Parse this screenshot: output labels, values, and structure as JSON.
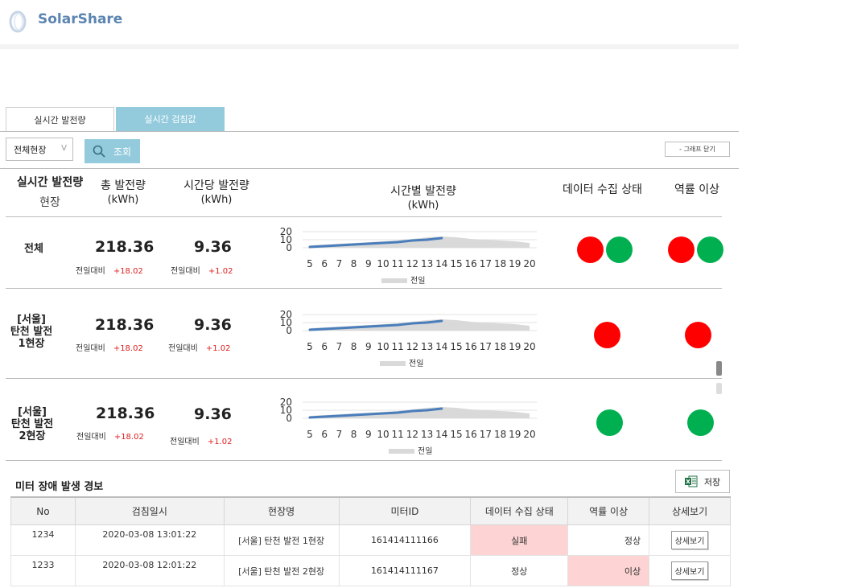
{
  "header": {
    "brand": "SolarShare"
  },
  "tabs": [
    {
      "label": "실시간 발전량"
    },
    {
      "label": "실시간 검침값"
    }
  ],
  "filter": {
    "site_select": "전체현장",
    "select_chevron": "V",
    "search_label": "조회",
    "graph_close_label": "- 그래프 닫기"
  },
  "columns": {
    "c1_top": "실시간 발전량",
    "c1_sub": "현장",
    "c2_top": "총 발전량",
    "c2_sub": "(kWh)",
    "c3_top": "시간당 발전량",
    "c3_sub": "(kWh)",
    "c4_top": "시간별 발전량",
    "c4_sub": "(kWh)",
    "c5_top": "데이터 수집 상태",
    "c6_top": "역률 이상"
  },
  "compare_label": "전일대비",
  "rows": [
    {
      "name_line1": "전체",
      "name_line2": "",
      "name_line3": "",
      "total": "218.36",
      "total_delta": "+18.02",
      "hourly": "9.36",
      "hourly_delta": "+1.02"
    },
    {
      "name_line1": "[서울]",
      "name_line2": "탄천 발전",
      "name_line3": "1현장",
      "total": "218.36",
      "total_delta": "+18.02",
      "hourly": "9.36",
      "hourly_delta": "+1.02"
    },
    {
      "name_line1": "[서울]",
      "name_line2": "탄천 발전",
      "name_line3": "2현장",
      "total": "218.36",
      "total_delta": "+18.02",
      "hourly": "9.36",
      "hourly_delta": "+1.02"
    }
  ],
  "status": {
    "row0": {
      "collect": [
        "red",
        "green"
      ],
      "power_factor": [
        "red",
        "green"
      ]
    },
    "row1": {
      "collect": [
        "red"
      ],
      "power_factor": [
        "red"
      ]
    },
    "row2": {
      "collect": [
        "green"
      ],
      "power_factor": [
        "green"
      ]
    }
  },
  "colors": {
    "red": "#ff0000",
    "green": "#00b050",
    "accent": "#93cbdc",
    "line": "#4a7ebb",
    "area": "#d9d9d9",
    "delta": "#e02020"
  },
  "chart_data": [
    {
      "type": "line",
      "x": [
        5,
        6,
        7,
        8,
        9,
        10,
        11,
        12,
        13,
        14,
        15,
        16,
        17,
        18,
        19,
        20
      ],
      "yticks": [
        0,
        10,
        20
      ],
      "ylim": [
        0,
        20
      ],
      "series": [
        {
          "values": [
            1,
            2,
            3,
            4,
            5,
            6,
            7,
            9,
            10,
            12
          ]
        },
        {
          "name": "전일",
          "type": "area",
          "values": [
            3,
            4,
            5,
            6,
            7,
            8,
            9,
            11,
            13,
            14,
            13,
            11,
            10,
            9,
            8,
            6
          ]
        }
      ]
    },
    {
      "type": "line",
      "x": [
        5,
        6,
        7,
        8,
        9,
        10,
        11,
        12,
        13,
        14,
        15,
        16,
        17,
        18,
        19,
        20
      ],
      "yticks": [
        0,
        10,
        20
      ],
      "ylim": [
        0,
        20
      ],
      "series": [
        {
          "values": [
            1,
            2,
            3,
            4,
            5,
            6,
            7,
            9,
            10,
            12
          ]
        },
        {
          "name": "전일",
          "type": "area",
          "values": [
            3,
            4,
            5,
            6,
            7,
            8,
            9,
            11,
            13,
            14,
            13,
            11,
            10,
            9,
            8,
            6
          ]
        }
      ]
    },
    {
      "type": "line",
      "x": [
        5,
        6,
        7,
        8,
        9,
        10,
        11,
        12,
        13,
        14,
        15,
        16,
        17,
        18,
        19,
        20
      ],
      "yticks": [
        0,
        10,
        20
      ],
      "ylim": [
        0,
        20
      ],
      "series": [
        {
          "values": [
            1,
            2,
            3,
            4,
            5,
            6,
            7,
            9,
            10,
            12
          ]
        },
        {
          "name": "전일",
          "type": "area",
          "values": [
            3,
            4,
            5,
            6,
            7,
            8,
            9,
            11,
            13,
            14,
            13,
            11,
            10,
            9,
            8,
            6
          ]
        }
      ]
    }
  ],
  "alert": {
    "title": "미터 장애 발생 경보",
    "save_label": "저장",
    "headers": [
      "No",
      "검침일시",
      "현장명",
      "미터ID",
      "데이터 수집 상태",
      "역률 이상",
      "상세보기"
    ],
    "rows": [
      {
        "no": "1234",
        "datetime": "2020-03-08 13:01:22",
        "site": "[서울] 탄천 발전 1현장",
        "meter": "161414111166",
        "collect": "실패",
        "pf": "정상",
        "detail": "상세보기"
      },
      {
        "no": "1233",
        "datetime": "2020-03-08 12:01:22",
        "site": "[서울] 탄천 발전 2현장",
        "meter": "161414111167",
        "collect": "정상",
        "pf": "이상",
        "detail": "상세보기"
      }
    ]
  }
}
